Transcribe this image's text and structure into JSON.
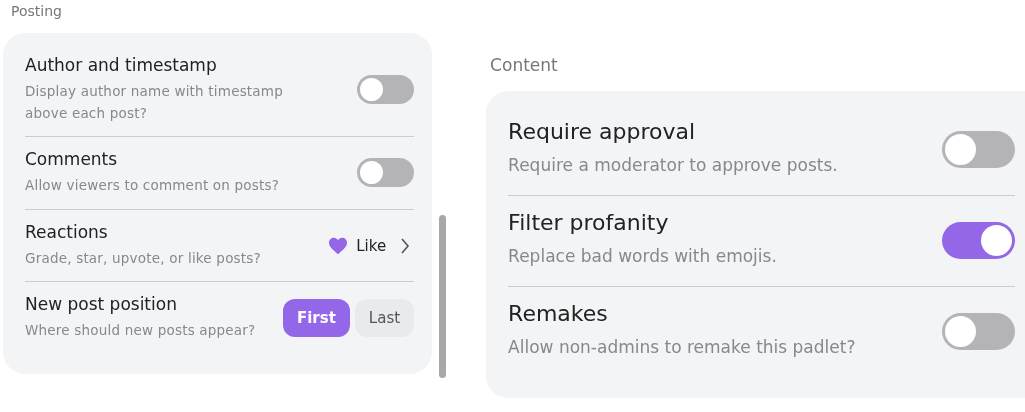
{
  "posting": {
    "heading": "Posting",
    "rows": [
      {
        "kind": "toggle",
        "title": "Author and timestamp",
        "description": "Display author name with timestamp above each post?",
        "on": false
      },
      {
        "kind": "toggle",
        "title": "Comments",
        "description": "Allow viewers to comment on posts?",
        "on": false
      },
      {
        "kind": "value",
        "title": "Reactions",
        "description": "Grade, star, upvote, or like posts?",
        "value": "Like"
      },
      {
        "kind": "segmented",
        "title": "New post position",
        "description": "Where should new posts appear?",
        "options": [
          {
            "label": "First",
            "selected": true
          },
          {
            "label": "Last",
            "selected": false
          }
        ]
      }
    ]
  },
  "content": {
    "heading": "Content",
    "rows": [
      {
        "kind": "toggle",
        "title": "Require approval",
        "description": "Require a moderator to approve posts.",
        "on": false
      },
      {
        "kind": "toggle",
        "title": "Filter profanity",
        "description": "Replace bad words with emojis.",
        "on": true
      },
      {
        "kind": "toggle",
        "title": "Remakes",
        "description": "Allow non-admins to remake this padlet?",
        "on": false
      }
    ]
  }
}
